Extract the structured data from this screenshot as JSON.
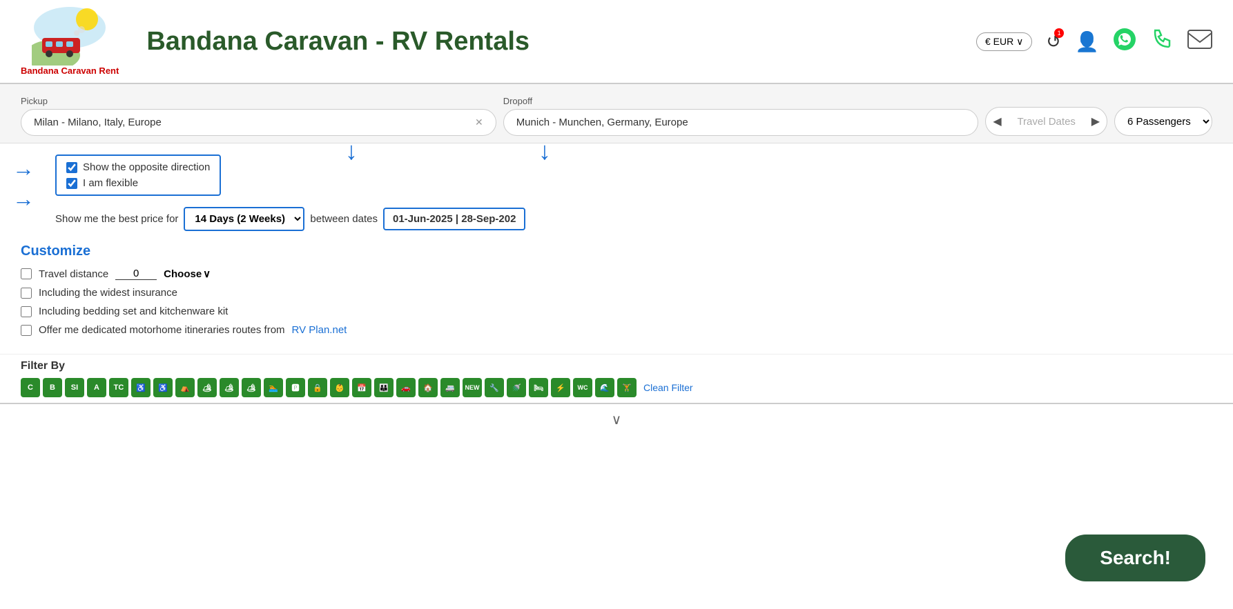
{
  "header": {
    "site_title": "Bandana Caravan - RV Rentals",
    "brand_name": "Bandana Caravan Rent",
    "currency": "€ EUR",
    "currency_chevron": "∨"
  },
  "search": {
    "pickup_label": "Pickup",
    "pickup_value": "Milan - Milano, Italy, Europe",
    "dropoff_label": "Dropoff",
    "dropoff_value": "Munich - Munchen, Germany, Europe",
    "travel_dates_label": "Travel Dates",
    "passengers_value": "6 Passengers"
  },
  "options": {
    "opposite_direction_label": "Show the opposite direction",
    "flexible_label": "I am flexible",
    "best_price_text": "Show me the best price for",
    "between_text": "between dates",
    "duration_value": "14 Days (2 Weeks)",
    "dates_value": "01-Jun-2025 | 28-Sep-202"
  },
  "customize": {
    "title": "Customize",
    "travel_distance_label": "Travel distance",
    "distance_value": "0",
    "choose_label": "Choose",
    "insurance_label": "Including the widest insurance",
    "bedding_label": "Including bedding set and kitchenware kit",
    "itineraries_label": "Offer me dedicated motorhome itineraries routes from",
    "rv_plan_link": "RV Plan.net"
  },
  "filter": {
    "title": "Filter By",
    "clean_filter": "Clean Filter",
    "icons": [
      "C",
      "B",
      "SI",
      "A",
      "TC",
      "♿",
      "♿",
      "⛺",
      "🏕",
      "🏕",
      "🏕",
      "🏊",
      "🅿",
      "🔒",
      "👶",
      "📅",
      "👨‍👩‍👧",
      "🚗",
      "🏠",
      "🚐",
      "NEW",
      "🔧",
      "🚿",
      "🛏",
      "⚡",
      "WC",
      "🌊",
      "🏋"
    ]
  },
  "search_button": {
    "label": "Search!"
  }
}
